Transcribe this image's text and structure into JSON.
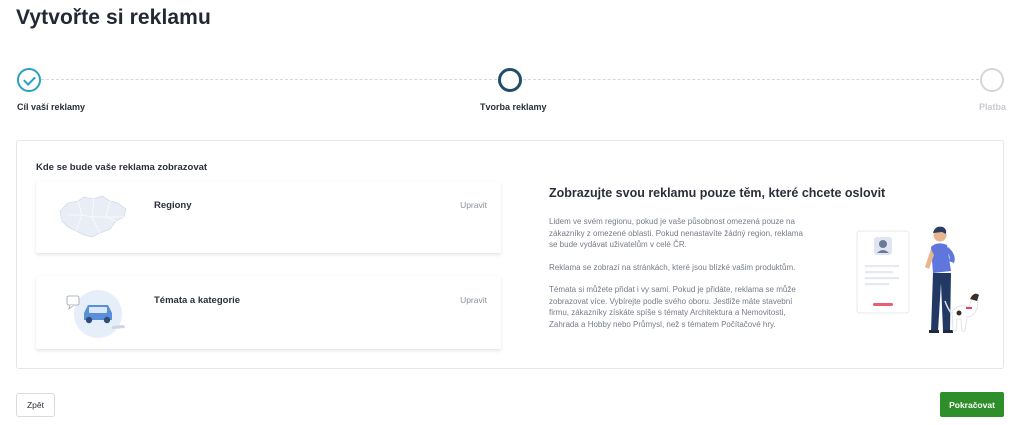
{
  "page": {
    "title": "Vytvořte si reklamu"
  },
  "stepper": {
    "steps": [
      {
        "label": "Cíl vaší reklamy",
        "state": "done"
      },
      {
        "label": "Tvorba reklamy",
        "state": "active"
      },
      {
        "label": "Platba",
        "state": "todo"
      }
    ]
  },
  "card": {
    "section_title": "Kde se bude vaše reklama zobrazovat",
    "options": [
      {
        "title": "Regiony",
        "edit_label": "Upravit"
      },
      {
        "title": "Témata a kategorie",
        "edit_label": "Upravit"
      }
    ],
    "info": {
      "title": "Zobrazujte svou reklamu pouze těm, které chcete oslovit",
      "paragraphs": [
        "Lidem ve svém regionu, pokud je vaše působnost omezená pouze na zákazníky z omezené oblasti. Pokud nenastavíte žádný region, reklama se bude vydávat uživatelům v celé ČR.",
        "Reklama se zobrazí na stránkách, které jsou blízké vašim produktům.",
        "Témata si můžete přidat i vy sami. Pokud je přidáte, reklama se může zobrazovat více. Vybírejte podle svého oboru. Jestliže máte stavební firmu, zákazníky získáte spíše s tématy Architektura a Nemovitosti, Zahrada a Hobby nebo Průmysl, než s tématem Počítačové hry."
      ]
    }
  },
  "footer": {
    "back_label": "Zpět",
    "next_label": "Pokračovat"
  },
  "colors": {
    "done": "#2aa0c4",
    "active": "#1f4f6b",
    "primary_button": "#2e8f2a"
  },
  "icons": {
    "step_done": "check-icon"
  }
}
